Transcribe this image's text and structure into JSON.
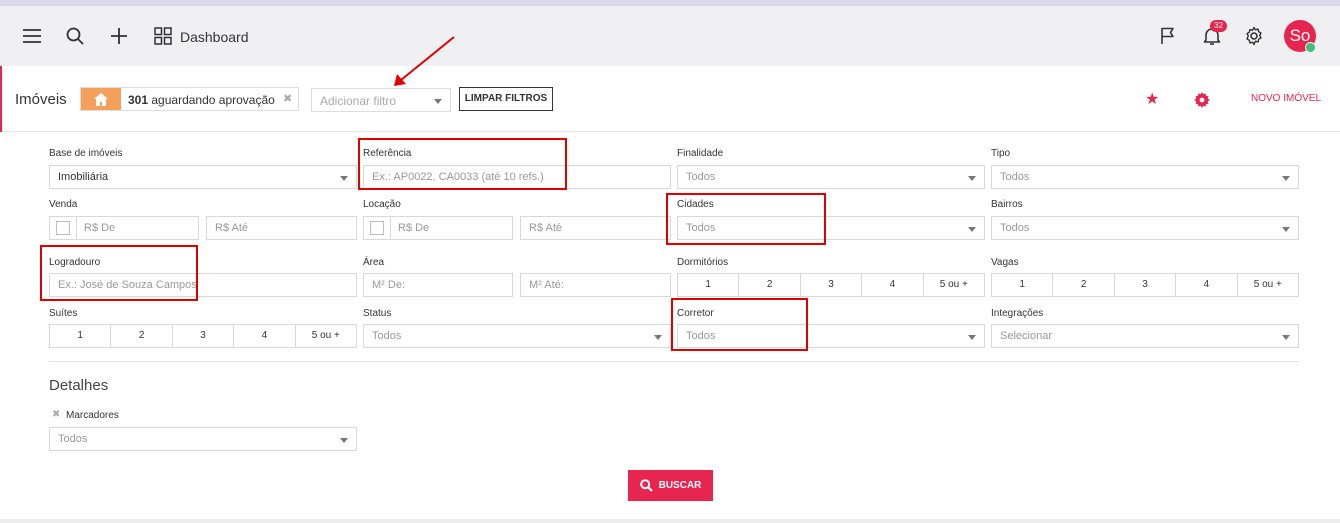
{
  "topbar": {
    "dashboard_label": "Dashboard",
    "notifications_count": "32",
    "avatar_initials": "So",
    "icons": [
      "menu-icon",
      "search-icon",
      "plus-icon",
      "grid-icon",
      "flag-icon",
      "bell-icon",
      "settings-icon"
    ]
  },
  "header": {
    "title": "Imóveis",
    "chip_count": "301",
    "chip_label": "aguardando aprovação",
    "chip_close": "✖",
    "add_filter_placeholder": "Adicionar filtro",
    "clear_filters_label": "LIMPAR FILTROS",
    "new_property_label": "NOVO IMÓVEL"
  },
  "filters": {
    "base": {
      "label": "Base de imóveis",
      "value": "Imobiliária"
    },
    "referencia": {
      "label": "Referência",
      "placeholder": "Ex.: AP0022, CA0033 (até 10 refs.)"
    },
    "finalidade": {
      "label": "Finalidade",
      "value": "Todos"
    },
    "tipo": {
      "label": "Tipo",
      "value": "Todos"
    },
    "venda": {
      "label": "Venda",
      "from_placeholder": "R$ De",
      "to_placeholder": "R$ Até"
    },
    "locacao": {
      "label": "Locação",
      "from_placeholder": "R$ De",
      "to_placeholder": "R$ Até"
    },
    "cidades": {
      "label": "Cidades",
      "value": "Todos"
    },
    "bairros": {
      "label": "Bairros",
      "value": "Todos"
    },
    "logradouro": {
      "label": "Logradouro",
      "placeholder": "Ex.: José de Souza Campos"
    },
    "area": {
      "label": "Área",
      "from_placeholder": "M² De:",
      "to_placeholder": "M² Até:"
    },
    "dormitorios": {
      "label": "Dormitórios",
      "options": [
        "1",
        "2",
        "3",
        "4",
        "5 ou +"
      ]
    },
    "vagas": {
      "label": "Vagas",
      "options": [
        "1",
        "2",
        "3",
        "4",
        "5 ou +"
      ]
    },
    "suites": {
      "label": "Suítes",
      "options": [
        "1",
        "2",
        "3",
        "4",
        "5 ou +"
      ]
    },
    "status": {
      "label": "Status",
      "value": "Todos"
    },
    "corretor": {
      "label": "Corretor",
      "value": "Todos"
    },
    "integracoes": {
      "label": "Integrações",
      "value": "Selecionar"
    }
  },
  "details": {
    "title": "Detalhes",
    "marcadores_label": "Marcadores",
    "marcadores_remove": "✖",
    "marcadores_value": "Todos"
  },
  "search_button_label": "BUSCAR",
  "annotation_color": "#e00000",
  "accent_color": "#e8254f"
}
